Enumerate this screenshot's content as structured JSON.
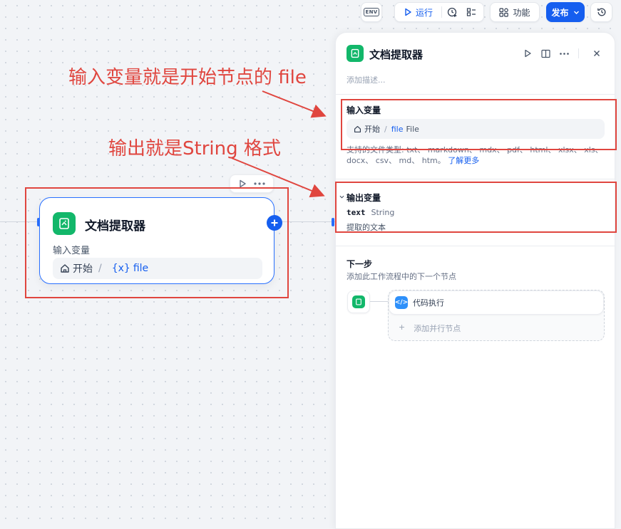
{
  "toolbar": {
    "env_label": "ENV",
    "run_label": "运行",
    "features_label": "功能",
    "publish_label": "发布"
  },
  "node": {
    "title": "文档提取器",
    "input_label": "输入变量",
    "var_source": "开始",
    "var_icon_text": "{x}",
    "var_name": "file"
  },
  "annotations": {
    "input_note": "输入变量就是开始节点的 file",
    "output_note": "输出就是String 格式"
  },
  "panel": {
    "title": "文档提取器",
    "description_placeholder": "添加描述...",
    "input_section": {
      "title": "输入变量",
      "source": "开始",
      "var_name": "file",
      "var_type": "File",
      "hint": "支持的文件类型: txt、 markdown、 mdx、 pdf、 html、 xlsx、 xls、 docx、 csv、 md、 htm。",
      "learn_more": "了解更多"
    },
    "output_section": {
      "title": "输出变量",
      "var_name": "text",
      "var_type": "String",
      "var_desc": "提取的文本"
    },
    "next_step": {
      "title": "下一步",
      "subtitle": "添加此工作流程中的下一个节点",
      "next_node": "代码执行",
      "add_parallel": "添加并行节点",
      "add_symbol": "+"
    }
  },
  "colors": {
    "accent": "#155eef",
    "node_green": "#12b76a",
    "annotation_red": "#e0463f"
  }
}
